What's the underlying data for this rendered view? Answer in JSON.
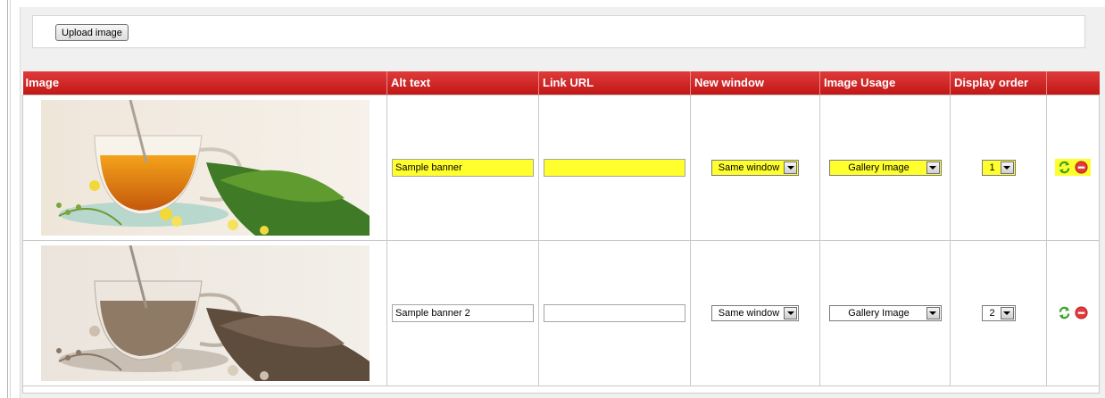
{
  "toolbar": {
    "upload_label": "Upload image"
  },
  "table": {
    "headers": [
      "Image",
      "Alt text",
      "Link URL",
      "New window",
      "Image Usage",
      "Display order",
      ""
    ],
    "rows": [
      {
        "image": "tea-cup-color",
        "alt_text": "Sample banner",
        "link_url": "",
        "new_window": "Same window",
        "usage": "Gallery Image",
        "display_order": "1",
        "highlighted": true
      },
      {
        "image": "tea-cup-sepia",
        "alt_text": "Sample banner 2",
        "link_url": "",
        "new_window": "Same window",
        "usage": "Gallery Image",
        "display_order": "2",
        "highlighted": false
      }
    ]
  },
  "colors": {
    "header_red": "#c21717",
    "highlight": "#ffff2e",
    "refresh_green": "#3aa427",
    "delete_red": "#e23b3b"
  },
  "icons": {
    "refresh": "refresh-icon",
    "delete": "delete-icon"
  }
}
